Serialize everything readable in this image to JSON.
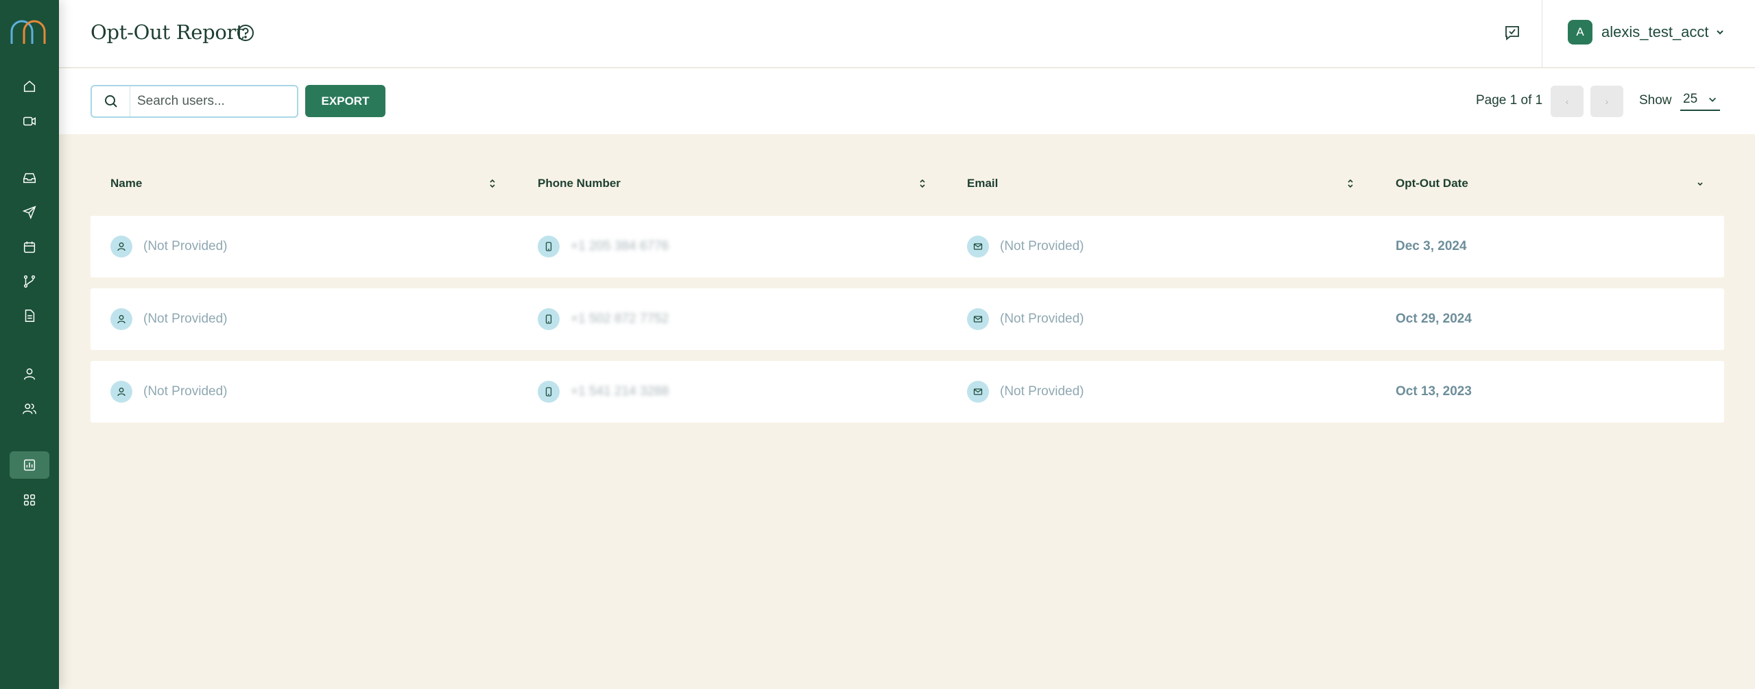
{
  "header": {
    "title": "Opt-Out Report",
    "account": {
      "initial": "A",
      "name": "alexis_test_acct"
    }
  },
  "sidebar": {
    "items": [
      {
        "name": "home",
        "icon": "home-icon"
      },
      {
        "name": "video",
        "icon": "video-icon"
      },
      {
        "name": "inbox",
        "icon": "inbox-icon"
      },
      {
        "name": "send",
        "icon": "send-icon"
      },
      {
        "name": "calendar",
        "icon": "calendar-icon"
      },
      {
        "name": "workflow",
        "icon": "workflow-icon"
      },
      {
        "name": "document",
        "icon": "document-icon"
      },
      {
        "name": "user",
        "icon": "user-icon"
      },
      {
        "name": "users",
        "icon": "users-icon"
      },
      {
        "name": "reports",
        "icon": "chart-icon",
        "active": true
      },
      {
        "name": "apps",
        "icon": "grid-icon"
      }
    ]
  },
  "toolbar": {
    "search_placeholder": "Search users...",
    "export_label": "EXPORT",
    "page_info": "Page 1 of 1",
    "prev_label": "‹",
    "next_label": "›",
    "show_label": "Show",
    "show_value": "25"
  },
  "table": {
    "columns": [
      "Name",
      "Phone Number",
      "Email",
      "Opt-Out Date"
    ],
    "rows": [
      {
        "name": "(Not Provided)",
        "phone": "+1 205 384 6776",
        "email": "(Not Provided)",
        "date": "Dec 3, 2024"
      },
      {
        "name": "(Not Provided)",
        "phone": "+1 502 872 7752",
        "email": "(Not Provided)",
        "date": "Oct 29, 2024"
      },
      {
        "name": "(Not Provided)",
        "phone": "+1 541 214 3288",
        "email": "(Not Provided)",
        "date": "Oct 13, 2023"
      }
    ]
  },
  "colors": {
    "sidebar": "#1b5139",
    "accent": "#2a7a5a",
    "background": "#f7f2e7",
    "icon_bubble": "#bfe3ec"
  }
}
